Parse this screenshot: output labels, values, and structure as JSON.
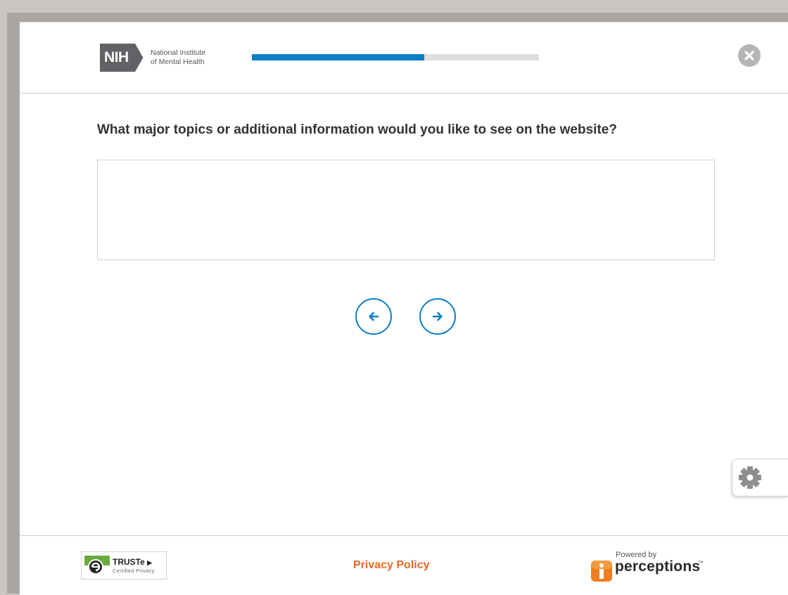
{
  "header": {
    "logo": {
      "abbr": "NIH",
      "line1": "National Institute",
      "line2": "of Mental Health"
    },
    "progress": {
      "fraction": 0.6
    },
    "close_icon": "close-icon"
  },
  "question": {
    "text": "What major topics or additional information would you like to see on the website?",
    "answer_value": "",
    "answer_placeholder": ""
  },
  "navigation": {
    "back_icon": "arrow-left-icon",
    "next_icon": "arrow-right-icon"
  },
  "settings": {
    "icon": "gear-icon"
  },
  "footer": {
    "truste": {
      "name": "TRUSTe",
      "sub": "Certified Privacy"
    },
    "privacy_link": "Privacy Policy",
    "powered": {
      "by": "Powered by",
      "name": "perceptions",
      "tm": "™"
    }
  },
  "colors": {
    "accent_blue": "#0b7fc4",
    "link_orange": "#e96a22",
    "logo_gray": "#616265"
  }
}
